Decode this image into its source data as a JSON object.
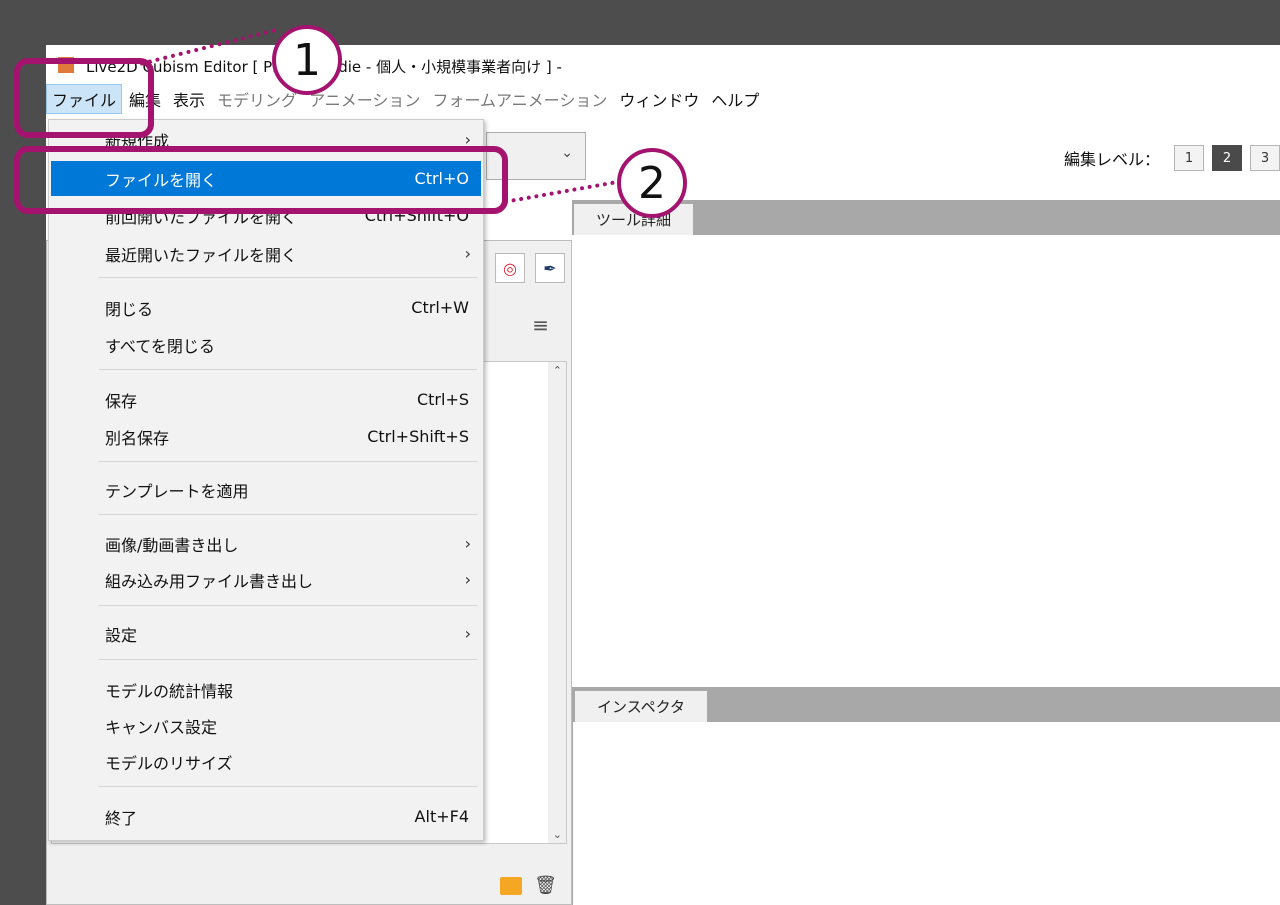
{
  "window": {
    "title": "Live2D Cubism Editor  [ PRO for indie - 個人・小規模事業者向け ] -"
  },
  "menubar": {
    "items": [
      {
        "label": "ファイル",
        "state": "active"
      },
      {
        "label": "編集",
        "state": "normal"
      },
      {
        "label": "表示",
        "state": "normal"
      },
      {
        "label": "モデリング",
        "state": "disabled"
      },
      {
        "label": "アニメーション",
        "state": "disabled"
      },
      {
        "label": "フォームアニメーション",
        "state": "disabled"
      },
      {
        "label": "ウィンドウ",
        "state": "normal"
      },
      {
        "label": "ヘルプ",
        "state": "normal"
      }
    ]
  },
  "edit_level": {
    "label": "編集レベル：",
    "levels": [
      "1",
      "2",
      "3"
    ],
    "selected": "2"
  },
  "panels": {
    "tool_detail": "ツール詳細",
    "inspector": "インスペクタ"
  },
  "file_menu": {
    "items": [
      {
        "label": "新規作成",
        "shortcut": "",
        "submenu": true
      },
      {
        "label": "ファイルを開く",
        "shortcut": "Ctrl+O",
        "submenu": false,
        "highlighted": true
      },
      {
        "label": "前回開いたファイルを開く",
        "shortcut": "Ctrl+Shift+O",
        "submenu": false
      },
      {
        "label": "最近開いたファイルを開く",
        "shortcut": "",
        "submenu": true
      },
      {
        "label": "閉じる",
        "shortcut": "Ctrl+W",
        "submenu": false
      },
      {
        "label": "すべてを閉じる",
        "shortcut": "",
        "submenu": false
      },
      {
        "label": "保存",
        "shortcut": "Ctrl+S",
        "submenu": false
      },
      {
        "label": "別名保存",
        "shortcut": "Ctrl+Shift+S",
        "submenu": false
      },
      {
        "label": "テンプレートを適用",
        "shortcut": "",
        "submenu": false
      },
      {
        "label": "画像/動画書き出し",
        "shortcut": "",
        "submenu": true
      },
      {
        "label": "組み込み用ファイル書き出し",
        "shortcut": "",
        "submenu": true
      },
      {
        "label": "設定",
        "shortcut": "",
        "submenu": true
      },
      {
        "label": "モデルの統計情報",
        "shortcut": "",
        "submenu": false
      },
      {
        "label": "キャンバス設定",
        "shortcut": "",
        "submenu": false
      },
      {
        "label": "モデルのリサイズ",
        "shortcut": "",
        "submenu": false
      },
      {
        "label": "終了",
        "shortcut": "Alt+F4",
        "submenu": false
      }
    ]
  },
  "annotations": {
    "step1": "1",
    "step2": "2"
  },
  "colors": {
    "annotation": "#a4146f",
    "highlight": "#0078d7",
    "app_icon": "#e07a3a"
  },
  "icons": {
    "submenu_arrow": "chevron-right-icon",
    "combo_arrow": "chevron-down-icon"
  }
}
